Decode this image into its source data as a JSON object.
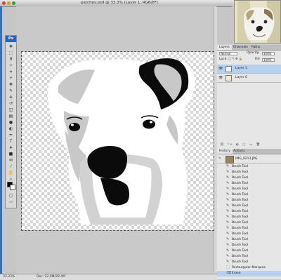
{
  "window": {
    "title": "patches.psd @ 33.3% (Layer 1, RGB/8*)"
  },
  "toolbox": {
    "logo": "Ps",
    "tools": [
      "move-icon",
      "marquee-icon",
      "lasso-icon",
      "magic-wand-icon",
      "crop-icon",
      "slice-icon",
      "healing-icon",
      "brush-icon",
      "stamp-icon",
      "history-brush-icon",
      "eraser-icon",
      "gradient-icon",
      "blur-icon",
      "dodge-icon",
      "pen-icon",
      "type-icon",
      "path-select-icon",
      "shape-icon",
      "notes-icon",
      "eyedropper-icon",
      "hand-icon",
      "zoom-icon"
    ],
    "tool_glyphs": [
      "✥",
      "⬚",
      "ϑ",
      "✧",
      "⌗",
      "⌿",
      "✚",
      "✎",
      "⎈",
      "↺",
      "◫",
      "▤",
      "●",
      "◐",
      "✒",
      "T",
      "➤",
      "■",
      "✉",
      "⁄",
      "✋",
      "⌕"
    ],
    "foreground_color": "#000000",
    "background_color": "#ffffff"
  },
  "status": {
    "zoom": "33.33%",
    "doc": "Doc: 22.0M/29.4M"
  },
  "layers_panel": {
    "tabs": [
      "Layers",
      "Channels",
      "Paths"
    ],
    "active_tab": "Layers",
    "blend_mode": "Normal",
    "opacity_label": "Opacity:",
    "opacity_value": "100%",
    "lock_label": "Lock:",
    "fill_label": "Fill:",
    "fill_value": "100%",
    "layers": [
      {
        "name": "Layer 1",
        "selected": true
      },
      {
        "name": "Layer 0",
        "selected": false
      }
    ]
  },
  "history_panel": {
    "tabs": [
      "History",
      "Actions"
    ],
    "active_tab": "History",
    "snapshot": "IMG_9213.JPG",
    "items": [
      "Brush Tool",
      "Brush Tool",
      "Brush Tool",
      "Brush Tool",
      "Brush Tool",
      "Brush Tool",
      "Brush Tool",
      "Brush Tool",
      "Brush Tool",
      "Brush Tool",
      "Brush Tool",
      "Brush Tool",
      "Brush Tool",
      "Brush Tool",
      "Brush Tool",
      "Brush Tool",
      "Brush Tool",
      "Brush Tool",
      "Rectangular Marquee",
      "Erase"
    ],
    "selected_index": 19
  },
  "colors": {
    "selection_blue": "#b8d0f0",
    "dog_gray": "#c8c8c8",
    "dog_black": "#0b0b0b"
  }
}
